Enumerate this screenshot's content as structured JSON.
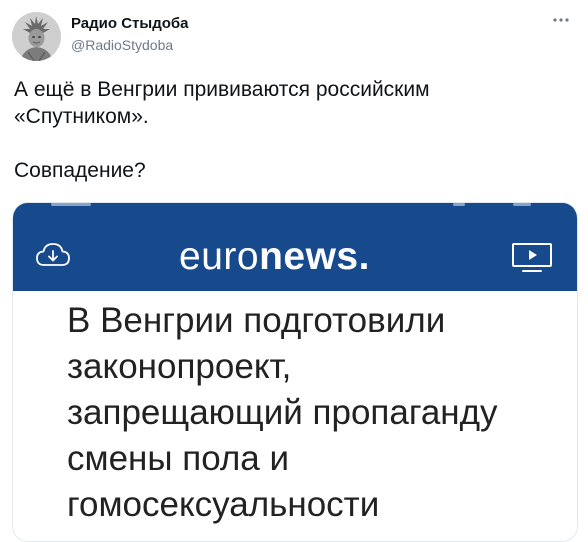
{
  "author": {
    "name": "Радио Стыдоба",
    "handle": "@RadioStydoba",
    "avatar_icon": "statue-avatar-icon"
  },
  "menu": {
    "more_icon": "more-horizontal-icon"
  },
  "tweet": {
    "lines": [
      "А ещё в Венгрии прививаются российским",
      "«Спутником».",
      "Совпадение?"
    ]
  },
  "media": {
    "brand_light": "euro",
    "brand_bold": "news.",
    "header_color": "#174a8d",
    "download_icon": "cloud-download-icon",
    "live_icon": "tv-play-icon",
    "headline_lines": [
      "В Венгрии подготовили",
      "законопроект,",
      "запрещающий пропаганду",
      "смены пола и",
      "гомосексуальности"
    ]
  }
}
